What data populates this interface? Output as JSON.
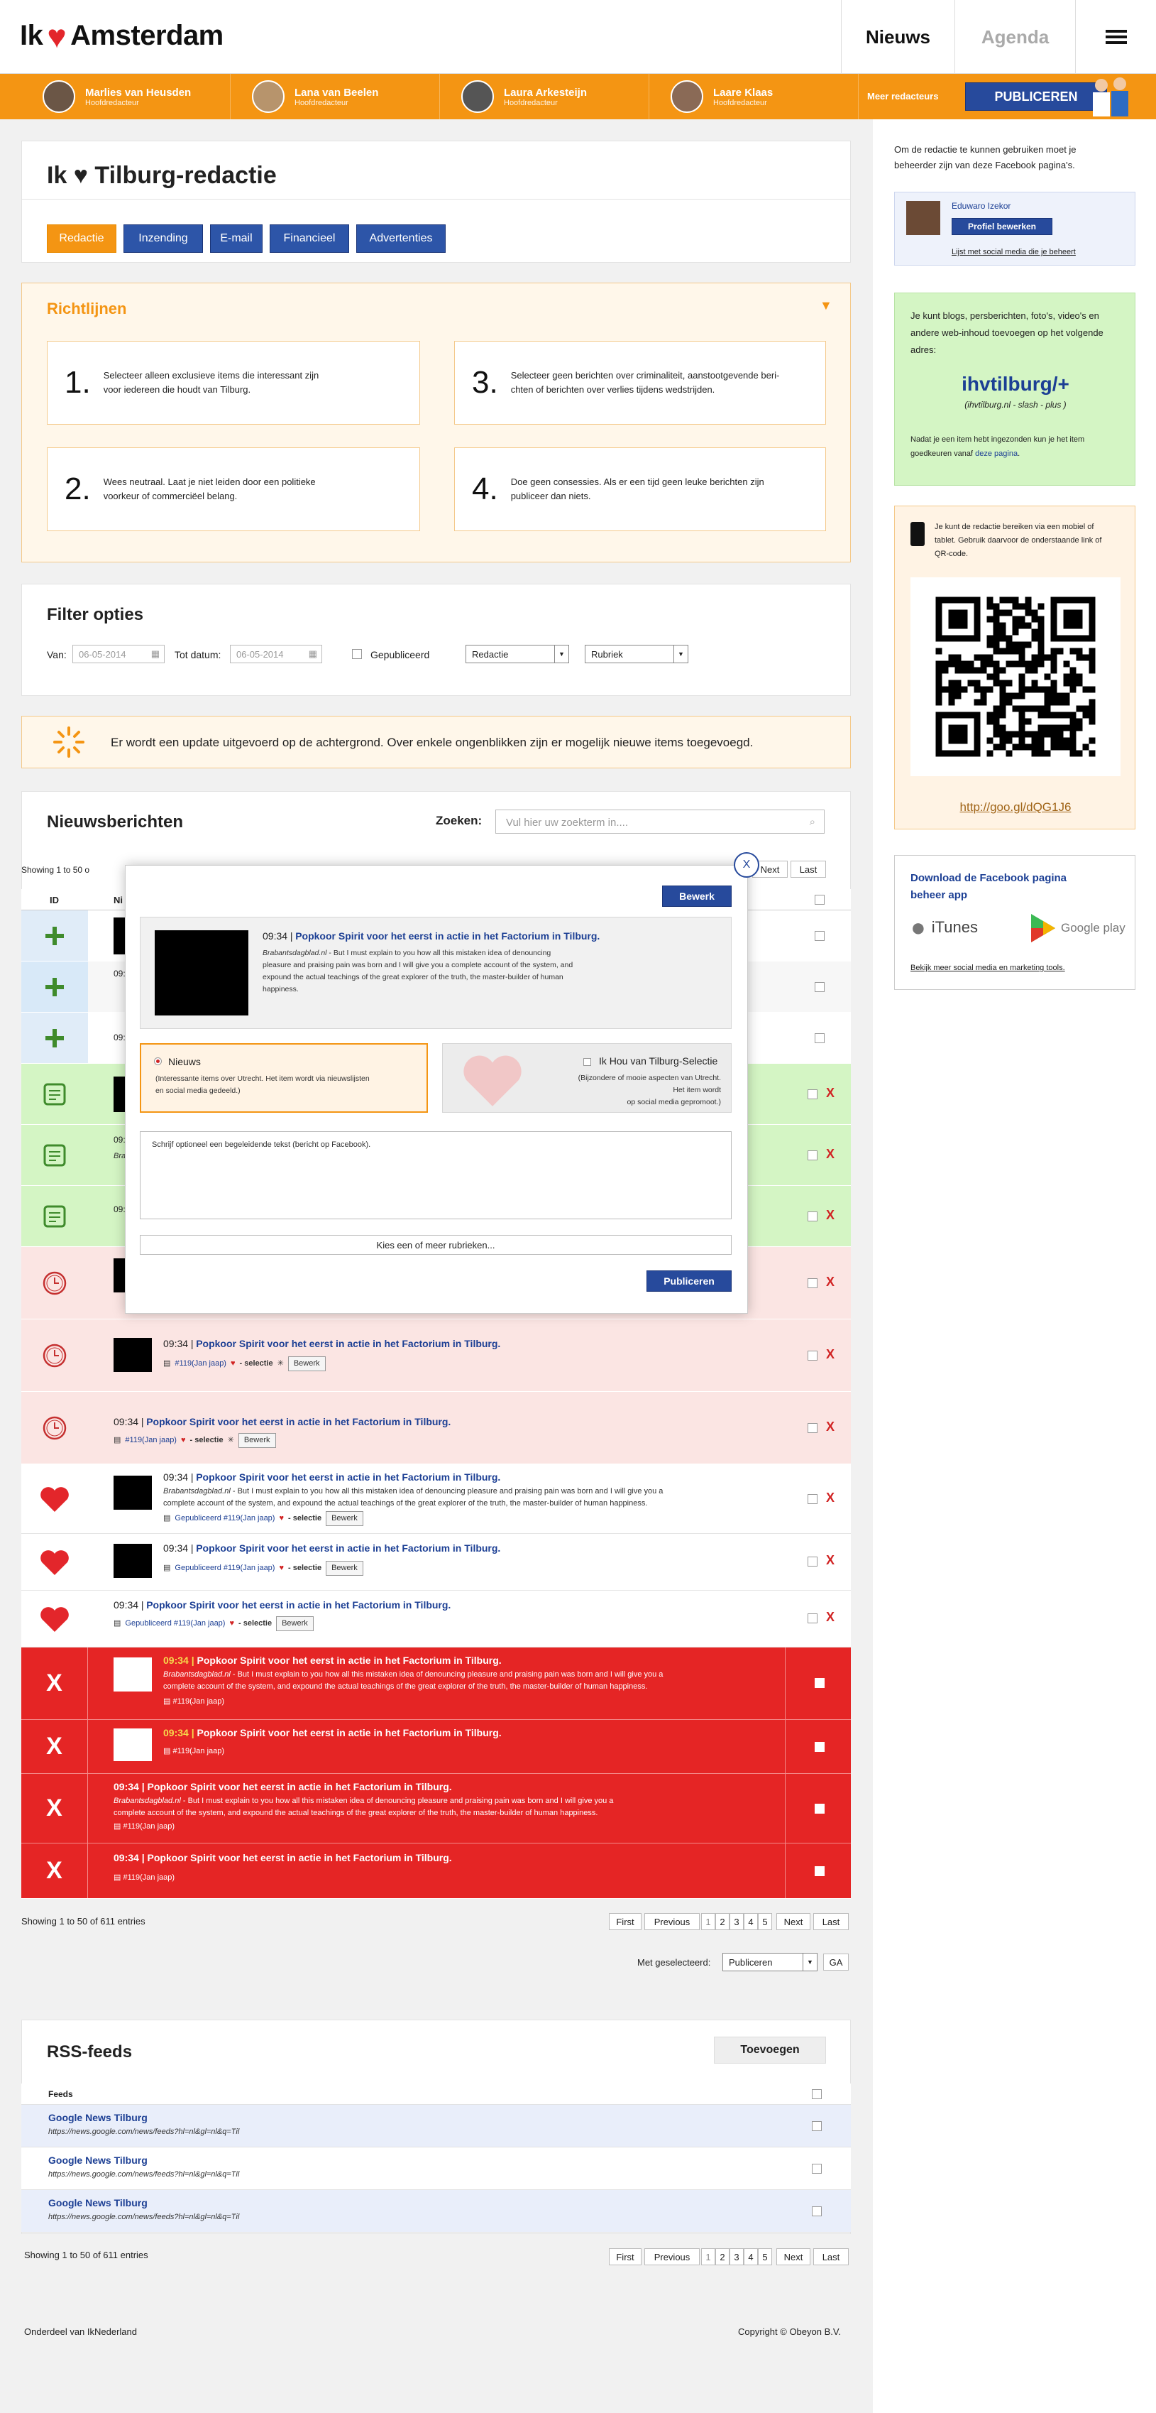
{
  "header": {
    "logo_left": "Ik",
    "logo_right": "Amsterdam",
    "nav": [
      "Nieuws",
      "Agenda"
    ]
  },
  "editors": [
    {
      "name": "Marlies van Heusden",
      "role": "Hoofdredacteur"
    },
    {
      "name": "Lana van Beelen",
      "role": "Hoofdredacteur"
    },
    {
      "name": "Laura Arkesteijn",
      "role": "Hoofdredacteur"
    },
    {
      "name": "Laare Klaas",
      "role": "Hoofdredacteur"
    }
  ],
  "editorbar": {
    "more": "Meer redacteurs",
    "publish": "PUBLICEREN"
  },
  "page": {
    "title": "Ik ♥ Tilburg-redactie",
    "tabs": [
      "Redactie",
      "Inzending",
      "E-mail",
      "Financieel",
      "Advertenties"
    ]
  },
  "guidelines": {
    "title": "Richtlijnen",
    "items": [
      {
        "n": "1.",
        "t1": "Selecteer alleen exclusieve items die interessant zijn",
        "t2": "voor iedereen die houdt van Tilburg."
      },
      {
        "n": "3.",
        "t1": "Selecteer geen berichten over criminaliteit, aanstootgevende beri-",
        "t2": "chten of berichten over verlies tijdens wedstrijden."
      },
      {
        "n": "2.",
        "t1": "Wees neutraal. Laat je niet leiden door een politieke",
        "t2": "voorkeur of commerciëel belang."
      },
      {
        "n": "4.",
        "t1": "Doe geen consessies. Als er een tijd geen leuke berichten zijn",
        "t2": "publiceer dan niets."
      }
    ]
  },
  "filter": {
    "title": "Filter opties",
    "van": "Van:",
    "van_val": "06-05-2014",
    "tot": "Tot datum:",
    "tot_val": "06-05-2014",
    "gepub": "Gepubliceerd",
    "sel1": "Redactie",
    "sel2": "Rubriek"
  },
  "notice": "Er wordt een update uitgevoerd op de achtergrond. Over enkele ongenblikken zijn er mogelijk nieuwe  items toegevoegd.",
  "news": {
    "title": "Nieuwsberichten",
    "search_label": "Zoeken:",
    "search_placeholder": "Vul hier uw zoekterm in....",
    "showing_top": "Showing 1 to 50 o",
    "next": "Next",
    "last": "Last",
    "col_id": "ID",
    "col_n": "Ni"
  },
  "item": {
    "time": "09:34 |",
    "title": "Popkoor Spirit voor het eerst in actie in het Factorium in Tilburg.",
    "source": "Brabantsdagblad.nl",
    "excerpt1": " - But I must explain to you how all this mistaken idea of denouncing pleasure and praising pain was born and I will give you a",
    "excerpt2": "complete account of the system, and expound the actual teachings of the great explorer of the truth, the master-builder of human happiness.",
    "tag": "#119(Jan jaap)",
    "gtag": "Gepubliceerd #119(Jan jaap)",
    "sel": "- selectie",
    "bewerk": "Bewerk"
  },
  "modal": {
    "bewerk": "Bewerk",
    "time": "09:34 |",
    "title": "Popkoor Spirit voor het eerst in actie in het Factorium in Tilburg.",
    "source": "Brabantsdagblad.nl",
    "ex1": " - But I must explain to you how all this mistaken idea of denouncing",
    "ex2": "pleasure and praising pain was born and I will give you a complete account of the system, and",
    "ex3": "expound the actual teachings of the great explorer of the truth, the master-builder of human",
    "ex4": "happiness.",
    "opt1": "Nieuws",
    "opt1_d1": "(Interessante items over Utrecht. Het item wordt via nieuwslijsten",
    "opt1_d2": "en social media gedeeld.)",
    "opt2": "Ik Hou van Tilburg-Selectie",
    "opt2_d1": "(Bijzondere of mooie aspecten van Utrecht. Het item wordt",
    "opt2_d2": "op social media gepromoot.)",
    "textarea": "Schrijf optioneel een begeleidende tekst (bericht op Facebook).",
    "rubriek": "Kies een of meer rubrieken...",
    "publish": "Publiceren",
    "close": "X"
  },
  "pager": {
    "showing": "Showing 1 to 50 of 611 entries",
    "first": "First",
    "prev": "Previous",
    "pages": [
      "1",
      "2",
      "3",
      "4",
      "5"
    ],
    "next": "Next",
    "last": "Last"
  },
  "bulk": {
    "label": "Met geselecteerd:",
    "option": "Publiceren",
    "go": "GA"
  },
  "rss": {
    "title": "RSS-feeds",
    "add": "Toevoegen",
    "col": "Feeds",
    "items": [
      {
        "name": "Google News Tilburg",
        "url": "https://news.google.com/news/feeds?hl=nl&gl=nl&q=Til"
      },
      {
        "name": "Google News Tilburg",
        "url": "https://news.google.com/news/feeds?hl=nl&gl=nl&q=Til"
      },
      {
        "name": "Google News Tilburg",
        "url": "https://news.google.com/news/feeds?hl=nl&gl=nl&q=Til"
      }
    ],
    "showing": "Showing 1 to 50 of 611 entries"
  },
  "footer": {
    "left": "Onderdeel van IkNederland",
    "right": "Copyright © Obeyon B.V."
  },
  "side": {
    "intro1": "Om de redactie te kunnen gebruiken moet je",
    "intro2": "beheerder zijn van deze Facebook pagina's.",
    "user": "Eduwaro Izekor",
    "profile_btn": "Profiel bewerken",
    "social_link": "Lijst met social media die je beheert",
    "g1": "Je kunt blogs, persberichten, foto's, video's en",
    "g2": "andere web-inhoud toevoegen op het volgende",
    "g3": "adres:",
    "url_big": "ihvtilburg/+",
    "url_small": "(ihvtilburg.nl - slash - plus )",
    "g4": "Nadat je een item hebt ingezonden kun je het item",
    "g5": "goedkeuren vanaf",
    "g5link": "deze pagina",
    "m1": "Je kunt de redactie bereiken via een mobiel of",
    "m2": "tablet. Gebruik daarvoor de onderstaande link of",
    "m3": "QR-code.",
    "qr_link": "http://goo.gl/dQG1J6",
    "fb_title1": "Download de Facebook pagina",
    "fb_title2": "beheer app",
    "itunes": "iTunes",
    "gplay": "Google play",
    "fb_link": "Bekijk meer social media en marketing tools."
  },
  "colors": {
    "orange": "#f49513",
    "blue": "#274a9c",
    "red": "#e52525",
    "green": "#d4f5c4",
    "pink": "#fbe5e3"
  }
}
